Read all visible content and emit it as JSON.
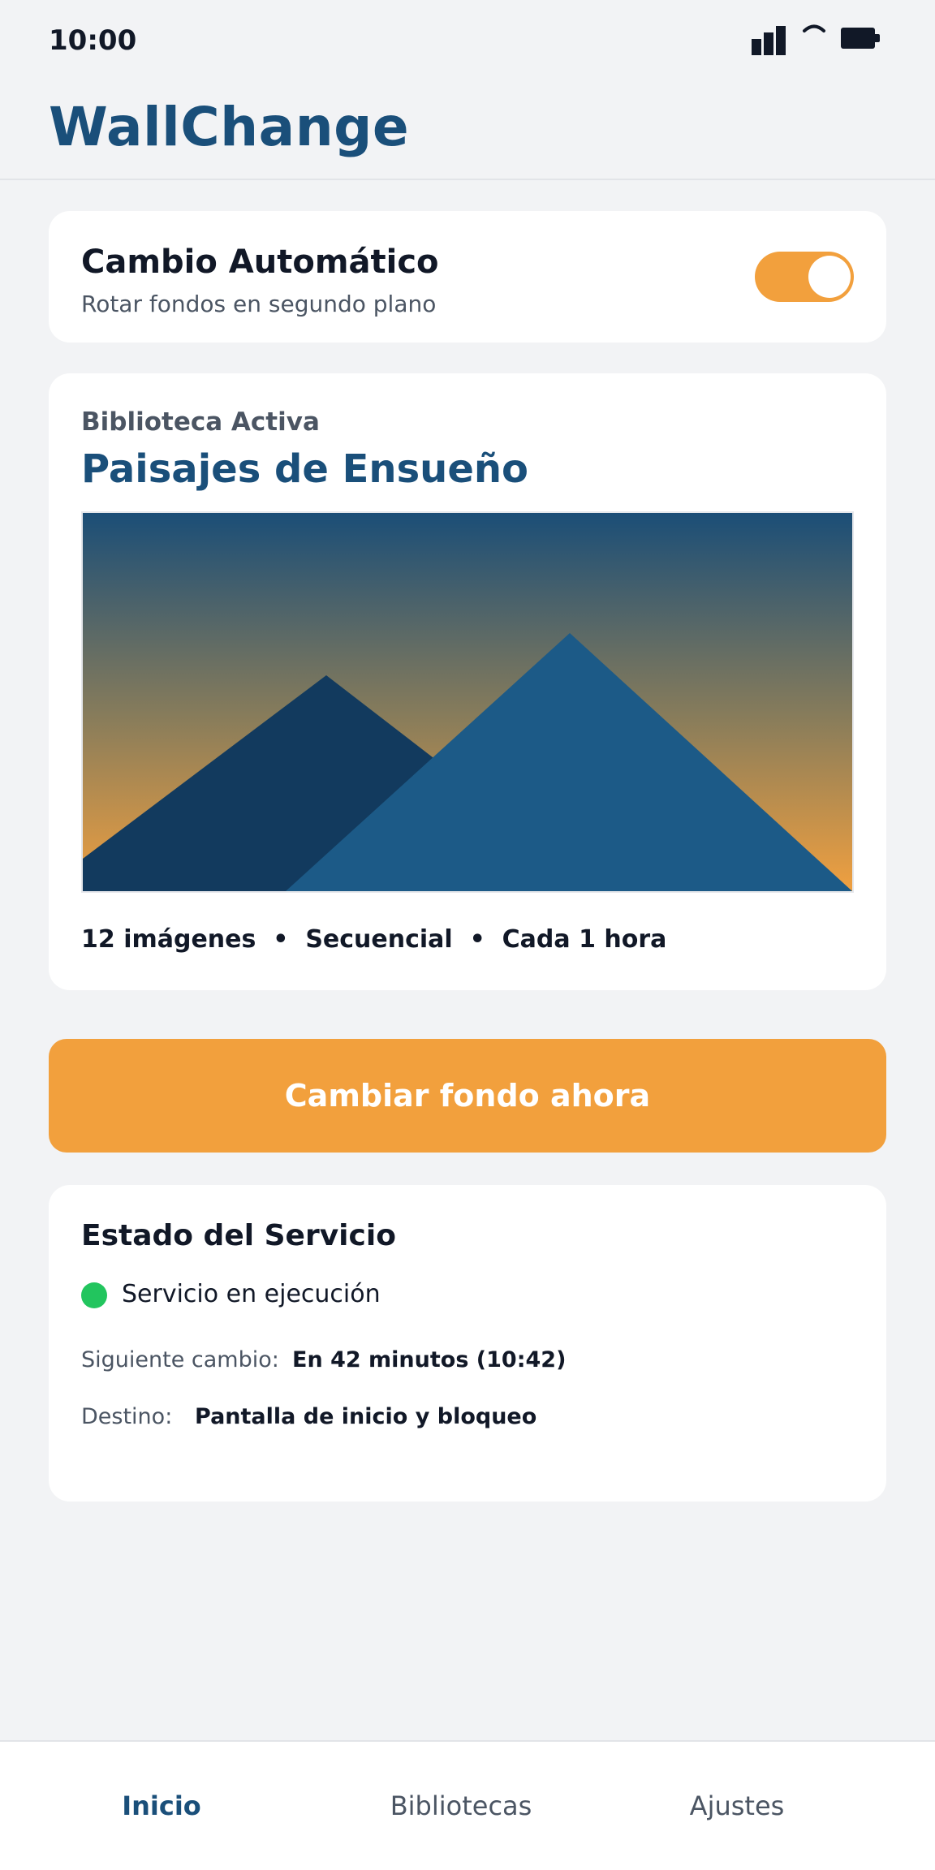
{
  "status_bar": {
    "time": "10:00",
    "icons": [
      "signal-icon",
      "wifi-icon",
      "battery-icon"
    ]
  },
  "header": {
    "title": "WallChange"
  },
  "auto_change": {
    "title": "Cambio Automático",
    "subtitle": "Rotar fondos en segundo plano",
    "enabled": true
  },
  "library": {
    "label": "Biblioteca Activa",
    "name": "Paisajes de Ensueño",
    "meta": "12 imágenes  •  Secuencial  •  Cada 1 hora"
  },
  "actions": {
    "change_now": "Cambiar fondo ahora"
  },
  "service": {
    "title": "Estado del Servicio",
    "status": "Servicio en ejecución",
    "next_label": "Siguiente cambio:",
    "next_value": "En 42 minutos (10:42)",
    "target_label": "Destino:",
    "target_value": "Pantalla de inicio y bloqueo"
  },
  "nav": {
    "items": [
      {
        "label": "Inicio",
        "active": true
      },
      {
        "label": "Bibliotecas",
        "active": false
      },
      {
        "label": "Ajustes",
        "active": false
      }
    ]
  },
  "colors": {
    "accent": "#f2a03d",
    "brand": "#1a4f7a",
    "status_ok": "#22c55e",
    "background": "#f2f3f5"
  }
}
